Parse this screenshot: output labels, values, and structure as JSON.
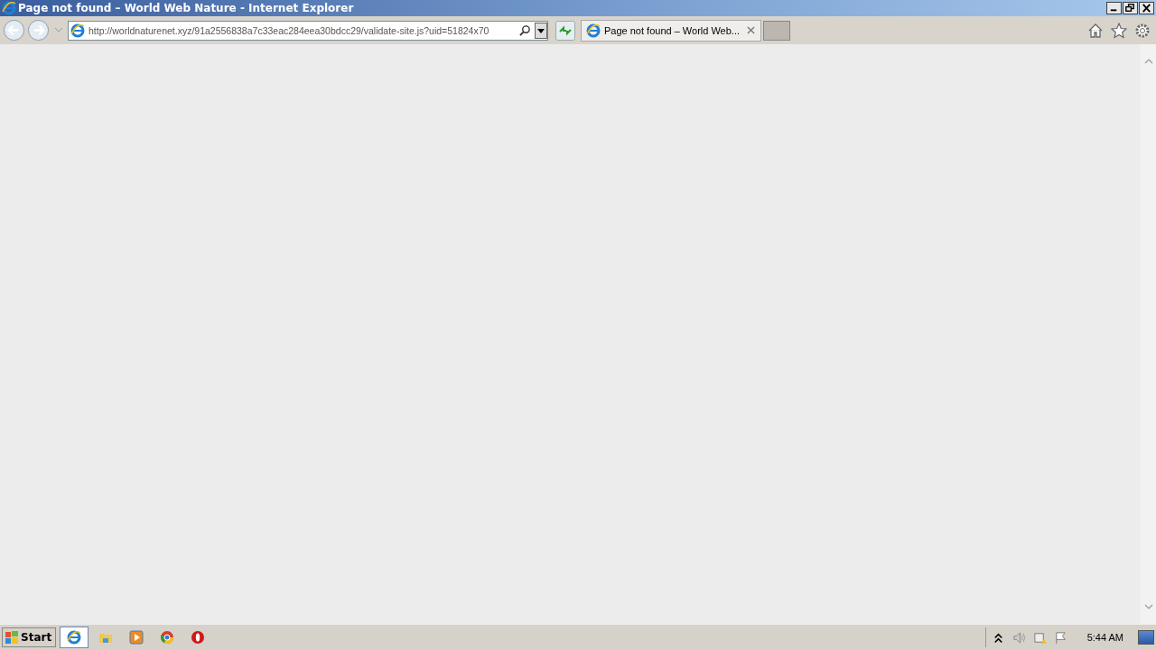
{
  "window": {
    "title": "Page not found – World Web Nature - Internet Explorer"
  },
  "address_bar": {
    "url": "http://worldnaturenet.xyz/91a2556838a7c33eac284eea30bdcc29/validate-site.js?uid=51824x70"
  },
  "tabs": [
    {
      "label": "Page not found – World Web...",
      "selected": true
    }
  ],
  "taskbar": {
    "start": "Start",
    "apps": [
      {
        "kind": "ie",
        "selected": true
      },
      {
        "kind": "folder",
        "selected": false
      },
      {
        "kind": "media",
        "selected": false
      },
      {
        "kind": "chrome",
        "selected": false
      },
      {
        "kind": "opera",
        "selected": false
      }
    ],
    "clock": "5:44 AM"
  }
}
